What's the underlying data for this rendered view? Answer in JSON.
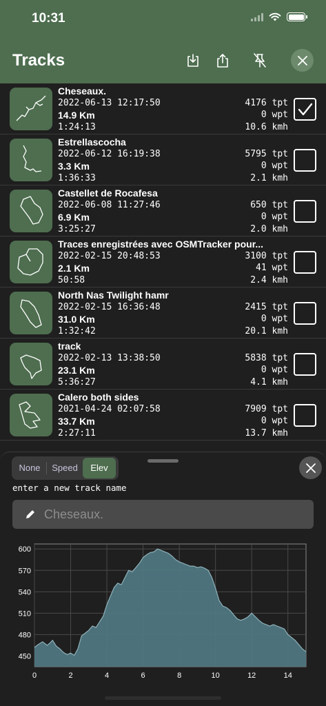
{
  "status": {
    "time": "10:31"
  },
  "header": {
    "title": "Tracks"
  },
  "tracks": [
    {
      "name": "Cheseaux.",
      "date": "2022-06-13 12:17:50",
      "distance": "14.9 Km",
      "duration": "1:24:13",
      "tpt": "4176 tpt",
      "wpt": "0 wpt",
      "speed": "10.6 kmh",
      "checked": true
    },
    {
      "name": "Estrellascocha",
      "date": "2022-06-12 16:19:38",
      "distance": "3.3 Km",
      "duration": "1:36:33",
      "tpt": "5795 tpt",
      "wpt": "0 wpt",
      "speed": "2.1 kmh",
      "checked": false
    },
    {
      "name": "Castellet de Rocafesa",
      "date": "2022-06-08 11:27:46",
      "distance": "6.9 Km",
      "duration": "3:25:27",
      "tpt": "650 tpt",
      "wpt": "0 wpt",
      "speed": "2.0 kmh",
      "checked": false
    },
    {
      "name": "Traces enregistrées avec OSMTracker pour...",
      "date": "2022-02-15 20:48:53",
      "distance": "2.1 Km",
      "duration": "50:58",
      "tpt": "3100 tpt",
      "wpt": "41 wpt",
      "speed": "2.4 kmh",
      "checked": false
    },
    {
      "name": "North Nas Twilight hamr",
      "date": "2022-02-15 16:36:48",
      "distance": "31.0 Km",
      "duration": "1:32:42",
      "tpt": "2415 tpt",
      "wpt": "0 wpt",
      "speed": "20.1 kmh",
      "checked": false
    },
    {
      "name": "track",
      "date": "2022-02-13 13:38:50",
      "distance": "23.1 Km",
      "duration": "5:36:27",
      "tpt": "5838 tpt",
      "wpt": "0 wpt",
      "speed": "4.1 kmh",
      "checked": false
    },
    {
      "name": "Calero both sides",
      "date": "2021-04-24 02:07:58",
      "distance": "33.7 Km",
      "duration": "2:27:11",
      "tpt": "7909 tpt",
      "wpt": "0 wpt",
      "speed": "13.7 kmh",
      "checked": false
    }
  ],
  "sheet": {
    "segments": [
      "None",
      "Speed",
      "Elev"
    ],
    "active_segment": "Elev",
    "prompt": "enter a new track name",
    "name_placeholder": "Cheseaux."
  },
  "colors": {
    "accent": "#4e6e4f",
    "chart_fill": "#4f7680",
    "chart_line": "#8fb2bb"
  },
  "chart_data": {
    "type": "area",
    "xlim": [
      0,
      15
    ],
    "ylim": [
      435,
      607
    ],
    "xticks": [
      0,
      2,
      4,
      6,
      8,
      10,
      12,
      14
    ],
    "yticks": [
      450,
      480,
      510,
      540,
      570,
      600
    ],
    "grid": true,
    "series": [
      {
        "x": [
          0,
          0.2,
          0.45,
          0.7,
          0.85,
          1.0,
          1.2,
          1.4,
          1.6,
          1.8,
          2.0,
          2.2,
          2.4,
          2.6,
          2.8,
          3.0,
          3.2,
          3.4,
          3.6,
          3.8,
          4.0,
          4.2,
          4.4,
          4.6,
          4.8,
          5.0,
          5.2,
          5.4,
          5.6,
          5.8,
          6.0,
          6.2,
          6.4,
          6.6,
          6.8,
          7.0,
          7.2,
          7.4,
          7.6,
          7.8,
          8.0,
          8.2,
          8.4,
          8.6,
          8.8,
          9.0,
          9.2,
          9.4,
          9.6,
          9.8,
          10.0,
          10.2,
          10.4,
          10.6,
          10.8,
          11.0,
          11.2,
          11.4,
          11.6,
          11.8,
          12.0,
          12.2,
          12.4,
          12.6,
          12.8,
          13.0,
          13.2,
          13.4,
          13.6,
          13.8,
          14.0,
          14.2,
          14.4,
          14.6,
          14.8,
          15.0
        ],
        "values": [
          462,
          466,
          470,
          465,
          468,
          472,
          464,
          460,
          455,
          452,
          454,
          451,
          460,
          478,
          482,
          486,
          492,
          490,
          498,
          506,
          522,
          534,
          546,
          552,
          550,
          560,
          570,
          568,
          574,
          580,
          588,
          592,
          595,
          596,
          600,
          598,
          596,
          594,
          590,
          585,
          582,
          580,
          578,
          576,
          576,
          574,
          575,
          573,
          570,
          560,
          545,
          528,
          520,
          518,
          514,
          508,
          502,
          500,
          502,
          505,
          510,
          505,
          500,
          496,
          494,
          492,
          494,
          492,
          490,
          488,
          480,
          476,
          472,
          466,
          460,
          456
        ]
      }
    ]
  }
}
